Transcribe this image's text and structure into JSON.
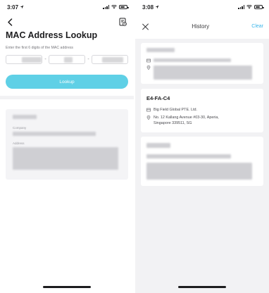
{
  "lookup_screen": {
    "status": {
      "time": "3:07"
    },
    "title": "MAC Address Lookup",
    "instruction": "Enter the first 6 digits of the MAC address",
    "mac_separator": "-",
    "lookup_button": "Lookup",
    "result": {
      "company_label": "Company",
      "address_label": "Address"
    },
    "icons": [
      "back-chevron-icon",
      "history-icon"
    ]
  },
  "history_screen": {
    "status": {
      "time": "3:08"
    },
    "title": "History",
    "clear": "Clear",
    "entries": [
      {
        "mac": "E4-FA-C4",
        "company": "Big Field Global PTE. Ltd.",
        "address_line1": "No. 12 Kallang Avenue #03-30, Aperia,",
        "address_line2": "Singapore   339511, SG"
      }
    ],
    "icons": [
      "close-icon",
      "building-icon",
      "location-pin-icon"
    ]
  },
  "colors": {
    "accent": "#5fd0e6",
    "link": "#3bb6ea",
    "background": "#f2f2f4"
  }
}
